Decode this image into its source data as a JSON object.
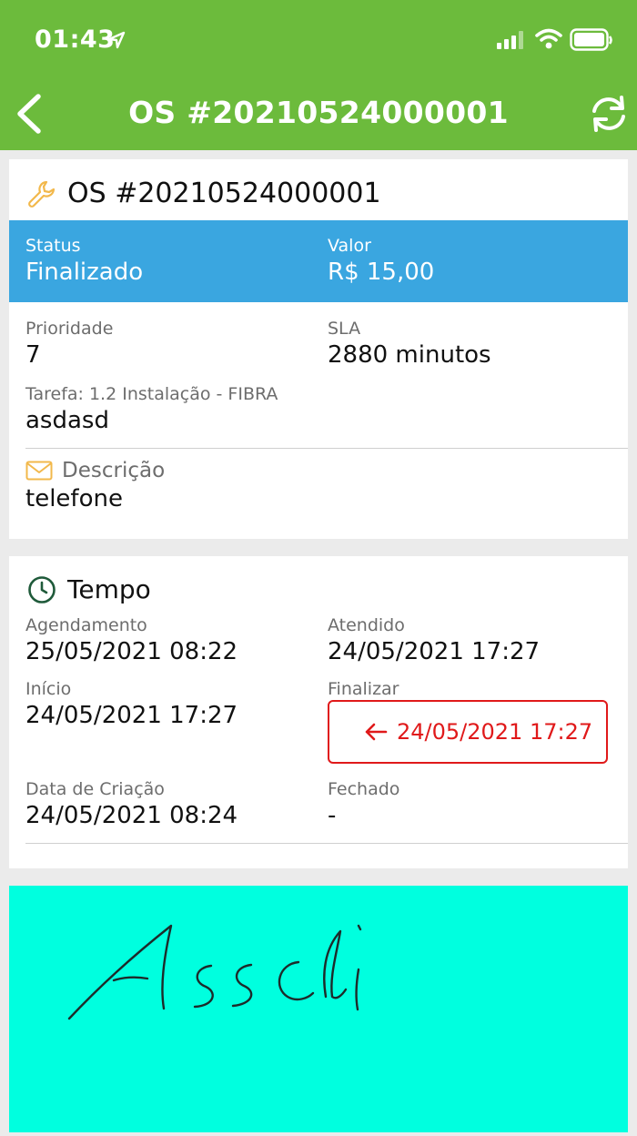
{
  "status_bar": {
    "time": "01:43"
  },
  "nav": {
    "title": "OS #20210524000001"
  },
  "order": {
    "title": "OS #20210524000001",
    "status_label": "Status",
    "status_value": "Finalizado",
    "value_label": "Valor",
    "value_value": "R$ 15,00",
    "priority_label": "Prioridade",
    "priority_value": "7",
    "sla_label": "SLA",
    "sla_value": "2880 minutos",
    "task_label": "Tarefa: 1.2 Instalação - FIBRA",
    "task_value": "asdasd",
    "description_label": "Descrição",
    "description_value": "telefone"
  },
  "time_card": {
    "title": "Tempo",
    "agendamento_label": "Agendamento",
    "agendamento_value": "25/05/2021 08:22",
    "atendido_label": "Atendido",
    "atendido_value": "24/05/2021 17:27",
    "inicio_label": "Início",
    "inicio_value": "24/05/2021 17:27",
    "finalizar_label": "Finalizar",
    "finalizar_value": "24/05/2021 17:27",
    "criacao_label": "Data de Criação",
    "criacao_value": "24/05/2021 08:24",
    "fechado_label": "Fechado",
    "fechado_value": "-"
  },
  "signature": {
    "text": "Asscli"
  },
  "colors": {
    "header": "#6cbb3c",
    "status_band": "#3aa6e0",
    "finalizar": "#e0191a",
    "signature_bg": "#00ffdf",
    "icon_orange": "#f2b84b",
    "clock_green": "#1f5a3a"
  }
}
